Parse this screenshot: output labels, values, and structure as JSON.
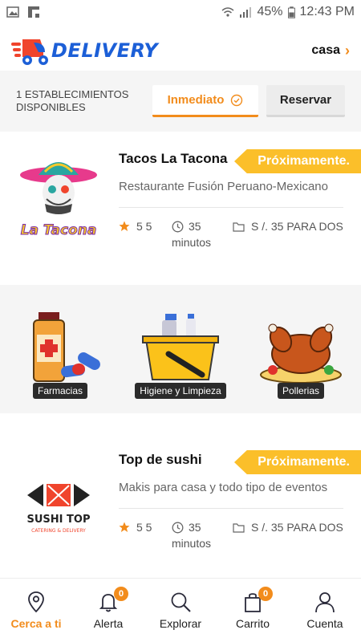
{
  "status_bar": {
    "battery": "45%",
    "time": "12:43 PM"
  },
  "header": {
    "brand": "DELIVERY",
    "location": "casa"
  },
  "filter": {
    "count_text": "1 ESTABLECIMIENTOS DISPONIBLES",
    "tab_immediate": "Inmediato",
    "tab_reserve": "Reservar"
  },
  "stores": [
    {
      "name": "Tacos La Tacona",
      "badge": "Próximamente.",
      "description": "Restaurante Fusión Peruano-Mexicano",
      "rating": "5 5",
      "time": "35",
      "time_unit": "minutos",
      "price": "S /. 35 PARA DOS",
      "logo_text": "La Tacona"
    },
    {
      "name": "Top de sushi",
      "badge": "Próximamente.",
      "description": "Makis para casa y todo tipo de eventos",
      "rating": "5 5",
      "time": "35",
      "time_unit": "minutos",
      "price": "S /. 35 PARA DOS",
      "logo_text": "SUSHI TOP",
      "logo_sub": "CATERING & DELIVERY"
    }
  ],
  "categories": [
    {
      "label": "Farmacias",
      "icon": "pharmacy-icon"
    },
    {
      "label": "Higiene y Limpieza",
      "icon": "cleaning-icon"
    },
    {
      "label": "Pollerias",
      "icon": "roast-chicken-icon"
    }
  ],
  "nav": [
    {
      "label": "Cerca a ti",
      "icon": "location-pin-icon",
      "active": true
    },
    {
      "label": "Alerta",
      "icon": "bell-icon",
      "badge": "0"
    },
    {
      "label": "Explorar",
      "icon": "search-icon"
    },
    {
      "label": "Carrito",
      "icon": "shopping-bag-icon",
      "badge": "0"
    },
    {
      "label": "Cuenta",
      "icon": "user-icon"
    }
  ],
  "colors": {
    "accent": "#f28c1c",
    "brand_blue": "#1c5fd7",
    "badge_yellow": "#fbbf2a"
  }
}
